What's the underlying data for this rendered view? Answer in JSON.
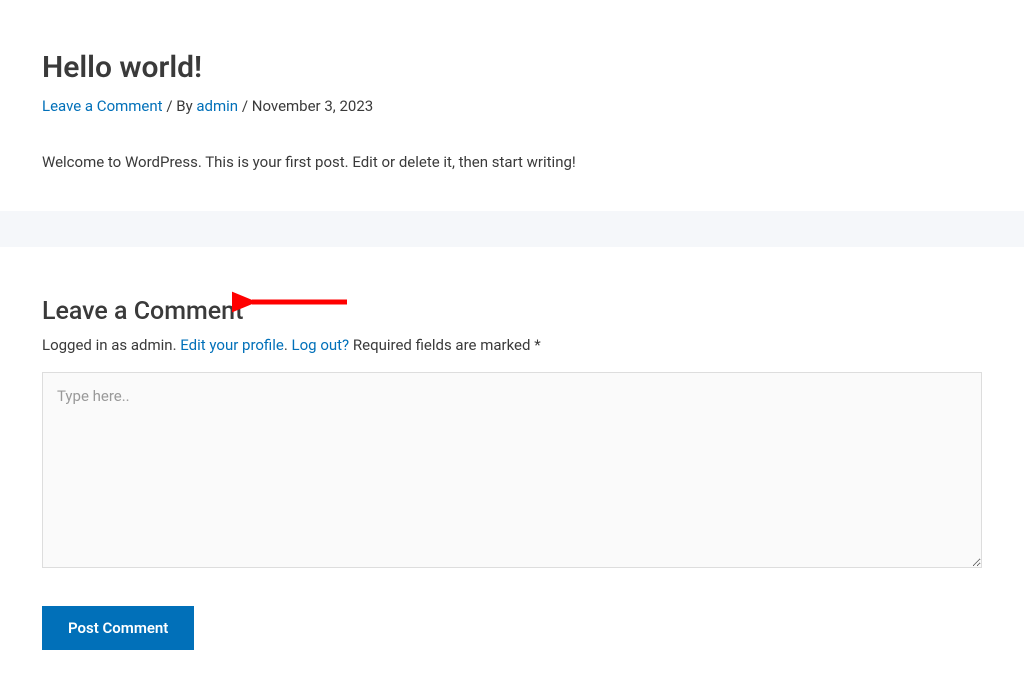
{
  "post": {
    "title": "Hello world!",
    "meta": {
      "leave_comment_link": "Leave a Comment",
      "by_sep": " / By ",
      "author": "admin",
      "date_sep": " / ",
      "date": "November 3, 2023"
    },
    "content": "Welcome to WordPress. This is your first post. Edit or delete it, then start writing!"
  },
  "comments": {
    "heading": "Leave a Comment",
    "logged_in_prefix": "Logged in as admin. ",
    "edit_profile_link": "Edit your profile",
    "dot_sep": ". ",
    "logout_link": "Log out?",
    "required_text": " Required fields are marked *",
    "textarea_placeholder": "Type here..",
    "submit_label": "Post Comment"
  }
}
